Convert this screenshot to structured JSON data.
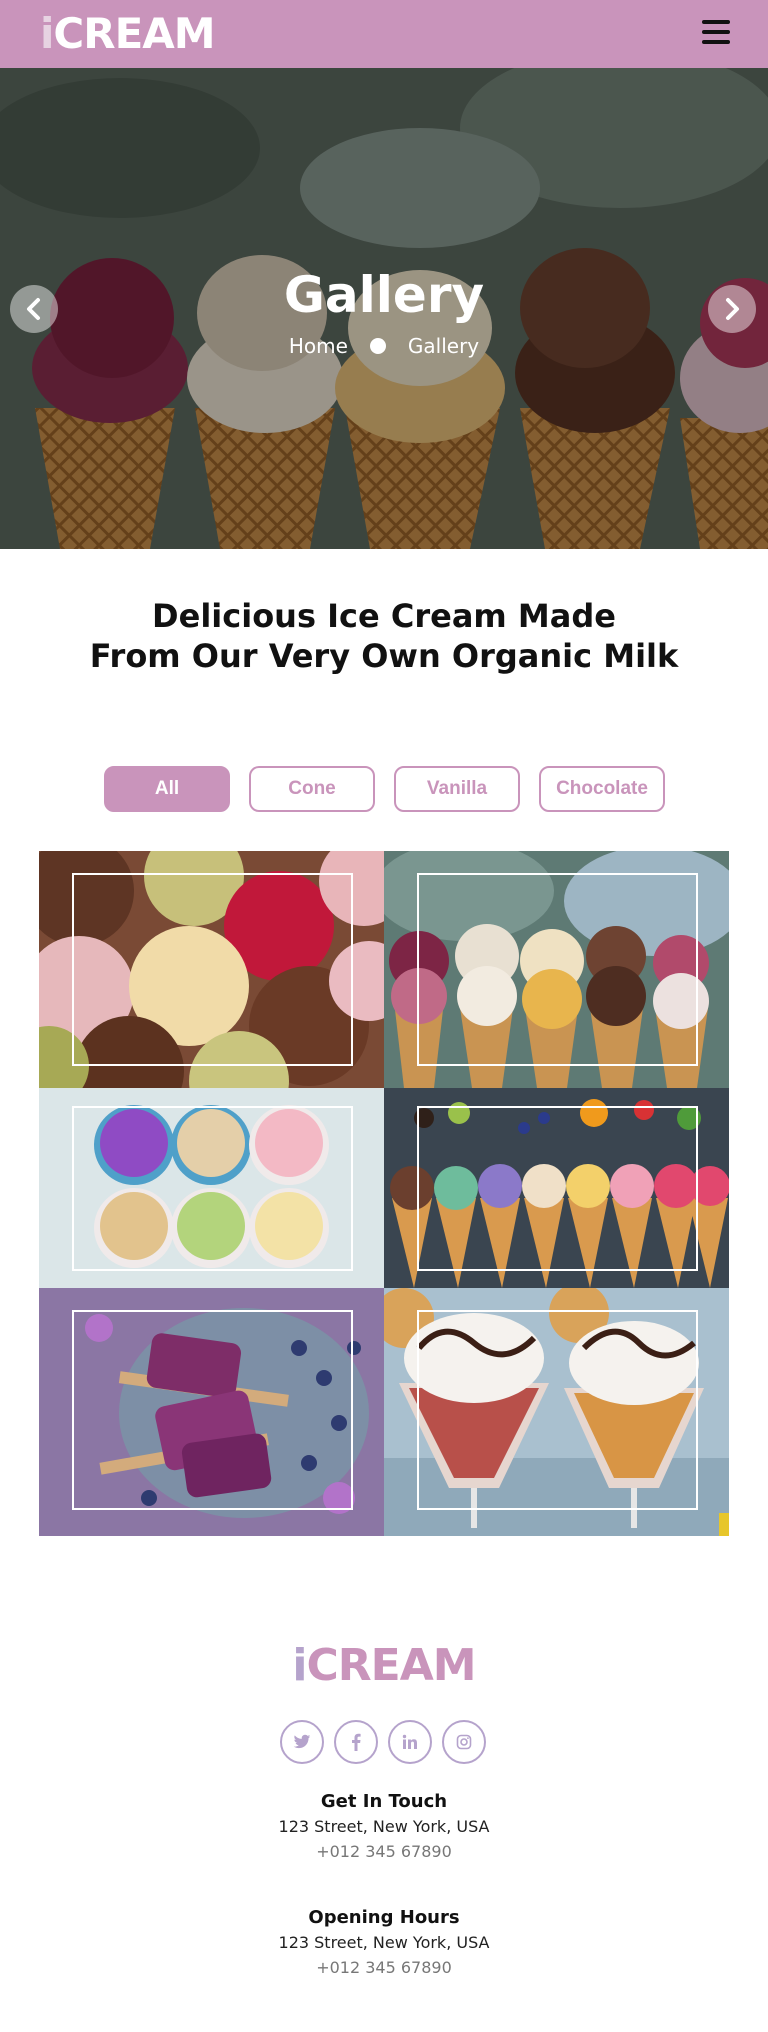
{
  "brand": {
    "logo_i": "i",
    "logo_rest": "CREAM"
  },
  "hero": {
    "title": "Gallery",
    "breadcrumb": [
      "Home",
      "Gallery"
    ]
  },
  "section": {
    "heading_line1": "Delicious Ice Cream Made",
    "heading_line2": "From Our Very Own Organic Milk"
  },
  "filters": [
    {
      "label": "All",
      "active": true
    },
    {
      "label": "Cone",
      "active": false
    },
    {
      "label": "Vanilla",
      "active": false
    },
    {
      "label": "Chocolate",
      "active": false
    }
  ],
  "gallery": [
    {
      "subject": "assorted ice cream scoops"
    },
    {
      "subject": "ice cream cones in a row"
    },
    {
      "subject": "ice cream cups"
    },
    {
      "subject": "colorful cones with fruit"
    },
    {
      "subject": "blueberry popsicles"
    },
    {
      "subject": "sundae glasses"
    }
  ],
  "footer": {
    "logo_i": "i",
    "logo_rest": "CREAM",
    "socials": [
      "twitter-icon",
      "facebook-icon",
      "linkedin-icon",
      "instagram-icon"
    ],
    "contact": {
      "heading": "Get In Touch",
      "address": "123 Street, New York, USA",
      "phone": "+012 345 67890"
    },
    "hours": {
      "heading": "Opening Hours",
      "address": "123 Street, New York, USA",
      "phone": "+012 345 67890"
    }
  },
  "colors": {
    "accent": "#c994bb",
    "accent_light": "#b5a3cc"
  }
}
